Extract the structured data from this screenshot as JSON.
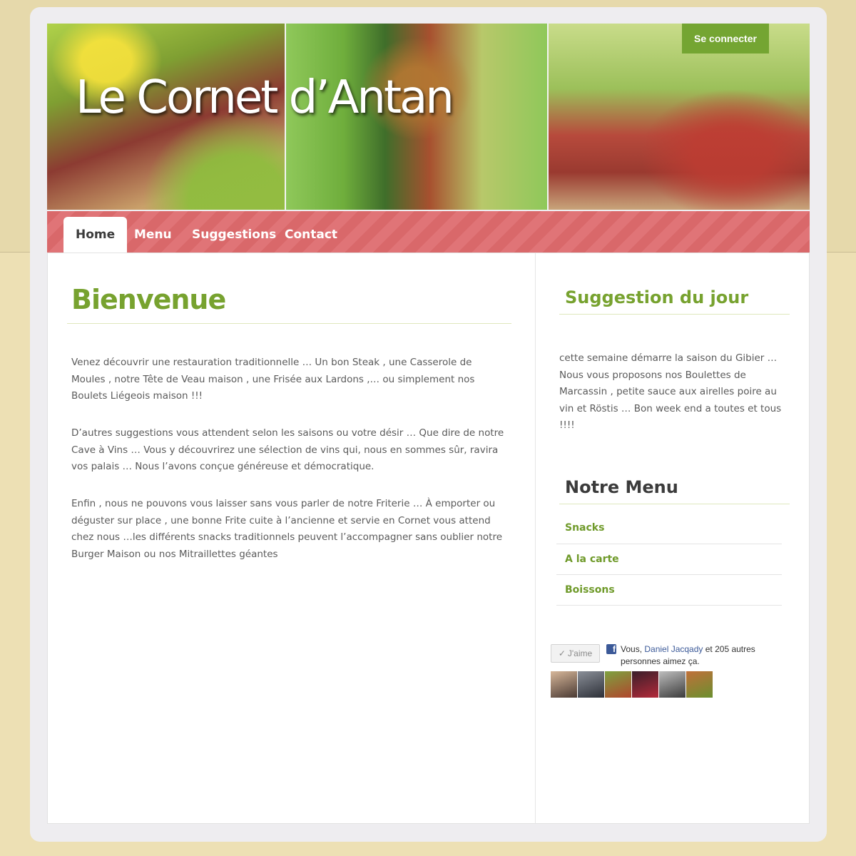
{
  "header": {
    "site_title": "Le Cornet d’Antan",
    "login_label": "Se connecter"
  },
  "nav": {
    "items": [
      {
        "label": "Home",
        "active": true
      },
      {
        "label": "Menu",
        "active": false
      },
      {
        "label": "Suggestions",
        "active": false
      },
      {
        "label": "Contact",
        "active": false
      }
    ]
  },
  "main": {
    "title": "Bienvenue",
    "paragraphs": [
      "Venez découvrir une restauration traditionnelle … Un bon Steak , une Casserole de Moules , notre Tête de Veau maison , une Frisée aux Lardons ,… ou simplement nos Boulets Liégeois maison !!!",
      "D’autres suggestions vous attendent selon les saisons ou votre désir … Que dire de notre Cave à Vins … Vous y découvrirez une sélection de vins qui, nous en sommes sûr, ravira vos palais … Nous l’avons conçue généreuse et démocratique.",
      "Enfin , nous ne pouvons vous laisser sans vous parler de notre Friterie … À emporter ou déguster sur place , une bonne Frite cuite à l’ancienne et servie en Cornet vous attend chez nous …les différents snacks traditionnels peuvent l’accompagner sans oublier notre Burger Maison ou nos Mitraillettes géantes"
    ]
  },
  "sidebar": {
    "suggestion_title": "Suggestion du jour",
    "suggestion_text": "cette semaine démarre la saison du Gibier … Nous vous proposons nos Boulettes de Marcassin , petite sauce aux airelles poire au vin et Röstis … Bon week end a toutes et tous !!!!",
    "menu_title": "Notre Menu",
    "menu_items": [
      {
        "label": "Snacks"
      },
      {
        "label": "A la carte"
      },
      {
        "label": "Boissons"
      }
    ]
  },
  "facebook": {
    "like_label": "J'aime",
    "text_prefix": "Vous, ",
    "friend_name": "Daniel Jacqady",
    "text_suffix": " et 205 autres personnes aimez ça."
  },
  "colors": {
    "accent_green": "#77a22f",
    "nav_red": "#d9686a",
    "heading_dark": "#3b3b3b",
    "background_cream": "#ede0b4"
  }
}
